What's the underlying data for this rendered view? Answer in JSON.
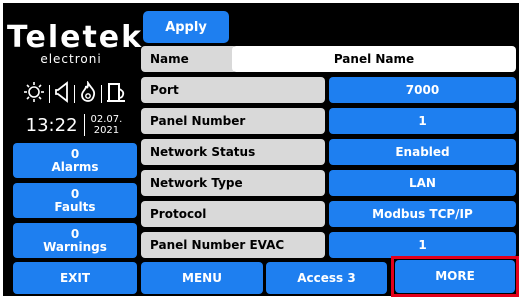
{
  "toolbar": {
    "apply_label": "Apply"
  },
  "brand": {
    "name": "Teletek",
    "sub": "electroni"
  },
  "status": {
    "time": "13:22",
    "date_line1": "02.07.",
    "date_line2": "2021"
  },
  "counters": [
    {
      "count": "0",
      "label": "Alarms"
    },
    {
      "count": "0",
      "label": "Faults"
    },
    {
      "count": "0",
      "label": "Warnings"
    }
  ],
  "fields": [
    {
      "label": "Name",
      "value": "Panel Name"
    },
    {
      "label": "Port",
      "value": "7000"
    },
    {
      "label": "Panel Number",
      "value": "1"
    },
    {
      "label": "Network Status",
      "value": "Enabled"
    },
    {
      "label": "Network Type",
      "value": "LAN"
    },
    {
      "label": "Protocol",
      "value": "Modbus TCP/IP"
    },
    {
      "label": "Panel Number EVAC",
      "value": "1"
    }
  ],
  "bottom": {
    "exit": "EXIT",
    "menu": "MENU",
    "access": "Access 3",
    "more": "MORE"
  },
  "icons": [
    "sun-icon",
    "speaker-icon",
    "fire-icon",
    "fire-door-icon"
  ],
  "colors": {
    "accent": "#1e7ff0",
    "background": "#000000",
    "highlight": "#e3001b"
  }
}
